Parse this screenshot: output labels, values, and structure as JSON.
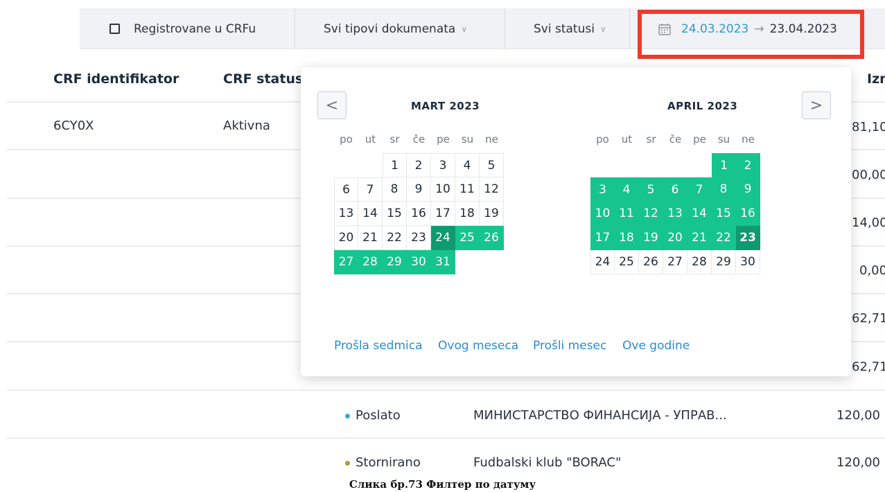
{
  "filters": {
    "checkbox_label": "Registrovane u CRFu",
    "doc_types": "Svi tipovi dokumenata",
    "statuses": "Svi statusi",
    "date_from": "24.03.2023",
    "date_arrow": "→",
    "date_to": "23.04.2023",
    "chevron": "∨"
  },
  "table": {
    "headers": [
      "CRF identifikator",
      "CRF status",
      "Izn"
    ],
    "row1": {
      "id": "6CY0X",
      "status": "Aktivna",
      "amount": "81,10"
    },
    "amounts": [
      "00,00",
      "14,00",
      "0,00",
      "62,71",
      "62,71"
    ],
    "row_poslato": {
      "status": "Poslato",
      "name": "МИНИСТАРСТВО ФИНАНСИЈА - УПРАВ...",
      "amount": "120,00"
    },
    "row_storno": {
      "status": "Stornirano",
      "name": "Fudbalski klub \"BORAC\"",
      "amount": "120,00"
    }
  },
  "datepicker": {
    "prev": "<",
    "next": ">",
    "left_month": "MART 2023",
    "right_month": "APRIL 2023",
    "weekdays": [
      "po",
      "ut",
      "sr",
      "če",
      "pe",
      "su",
      "ne"
    ],
    "selection": {
      "start": "24.03.2023",
      "end": "23.04.2023"
    },
    "quick_links": [
      "Prošla sedmica",
      "Ovog meseca",
      "Prošli mesec",
      "Ove godine"
    ]
  },
  "colors": {
    "accent": "#16c48e",
    "accent_dark": "#0f9a70",
    "link": "#2a8bd6",
    "highlight_box": "#ec3b2c"
  },
  "caption": "Слика бр.73 Филтер по датуму"
}
